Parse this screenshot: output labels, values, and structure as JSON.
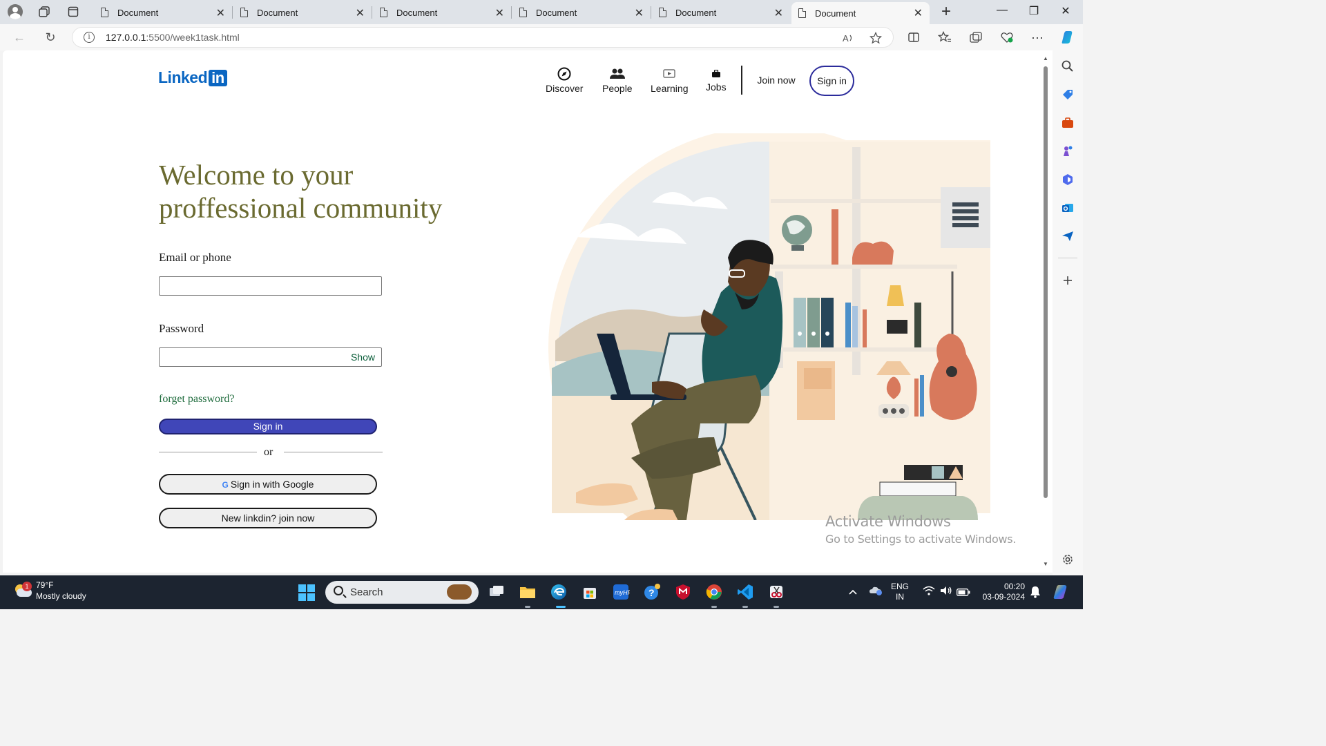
{
  "browser": {
    "tabs": [
      {
        "title": "Document",
        "active": false
      },
      {
        "title": "Document",
        "active": false
      },
      {
        "title": "Document",
        "active": false
      },
      {
        "title": "Document",
        "active": false
      },
      {
        "title": "Document",
        "active": false
      },
      {
        "title": "Document",
        "active": true
      }
    ],
    "url_host": "127.0.0.1",
    "url_path": ":5500/week1task.html",
    "new_tab_glyph": "+",
    "tab_close_glyph": "✕",
    "window_controls": {
      "minimize": "—",
      "restore": "❐",
      "close": "✕"
    },
    "toolbar_glyphs": {
      "back": "←",
      "reload": "↻",
      "more": "···",
      "info": "i"
    }
  },
  "page": {
    "logo": {
      "text": "Linked",
      "badge": "in"
    },
    "nav": {
      "discover": "Discover",
      "people": "People",
      "learning": "Learning",
      "jobs": "Jobs",
      "join_now": "Join now",
      "sign_in": "Sign in"
    },
    "headline": "Welcome to your proffessional community",
    "form": {
      "email_label": "Email or phone",
      "email_value": "",
      "password_label": "Password",
      "password_value": "",
      "show_label": "Show",
      "forget_password": "forget password?",
      "sign_in_button": "Sign in",
      "or_text": "or",
      "google_g": "G",
      "google_button": "Sign in with Google",
      "join_button": "New linkdin? join now"
    },
    "watermark": {
      "line1": "Activate Windows",
      "line2": "Go to Settings to activate Windows."
    }
  },
  "taskbar": {
    "weather": {
      "temp": "79°F",
      "condition": "Mostly cloudy",
      "badge": "1"
    },
    "search_placeholder": "Search",
    "tray": {
      "lang_line1": "ENG",
      "lang_line2": "IN",
      "time": "00:20",
      "date": "03-09-2024"
    }
  },
  "colors": {
    "linkedin_blue": "#0a66c2",
    "headline_olive": "#6a6a30",
    "signin_purple": "#4046b8",
    "taskbar_bg": "#1c2430"
  }
}
